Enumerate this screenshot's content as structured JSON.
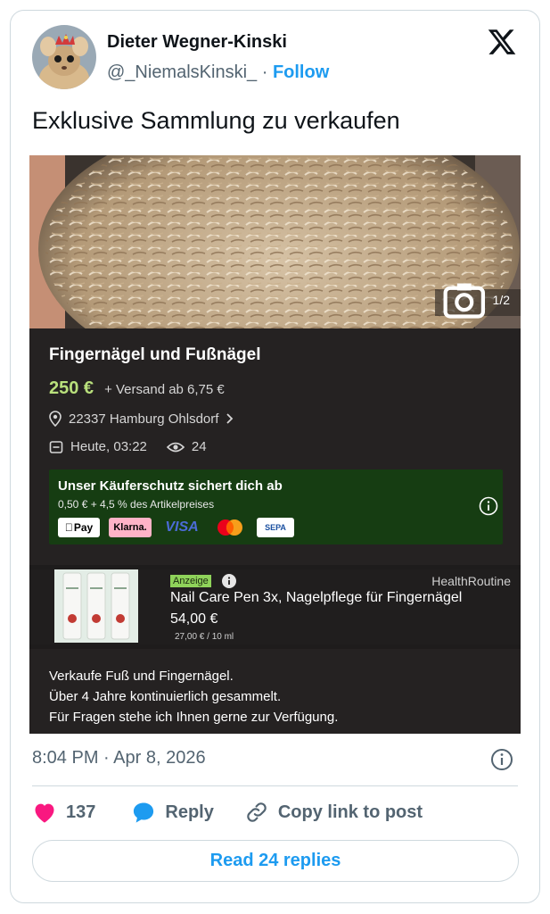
{
  "author": {
    "display_name": "Dieter Wegner-Kinski",
    "handle": "@_NiemalsKinski_",
    "separator": "·",
    "follow_label": "Follow"
  },
  "tweet": {
    "text": "Exklusive Sammlung zu verkaufen",
    "timestamp": "8:04 PM · Apr 8, 2026"
  },
  "listing": {
    "photo_counter": "1/2",
    "title": "Fingernägel und Fußnägel",
    "price": "250 €",
    "shipping": "+ Versand ab 6,75 €",
    "location": "22337 Hamburg Ohlsdorf",
    "posted": "Heute, 03:22",
    "views": "24",
    "buyer_protection": {
      "title": "Unser Käuferschutz sichert dich ab",
      "subtitle": "0,50 € + 4,5 % des Artikelpreises",
      "payment_methods": [
        "Pay",
        "Klarna.",
        "VISA",
        "SEPA"
      ]
    },
    "ad": {
      "badge": "Anzeige",
      "brand": "HealthRoutine",
      "product": "Nail Care Pen 3x, Nagelpflege für Fingernägel",
      "price": "54,00 €",
      "unit_price": "27,00 € / 10 ml"
    },
    "description": [
      "Verkaufe Fuß und Fingernägel.",
      "Über 4 Jahre kontinuierlich gesammelt.",
      "Für Fragen stehe ich Ihnen gerne zur Verfügung."
    ]
  },
  "actions": {
    "likes": "137",
    "reply_label": "Reply",
    "copy_link_label": "Copy link to post"
  },
  "read_replies_label": "Read 24 replies",
  "colors": {
    "accent": "#1d9bf0",
    "like": "#f91880",
    "price_green": "#b9e07c",
    "protection_bg": "#163d12"
  }
}
